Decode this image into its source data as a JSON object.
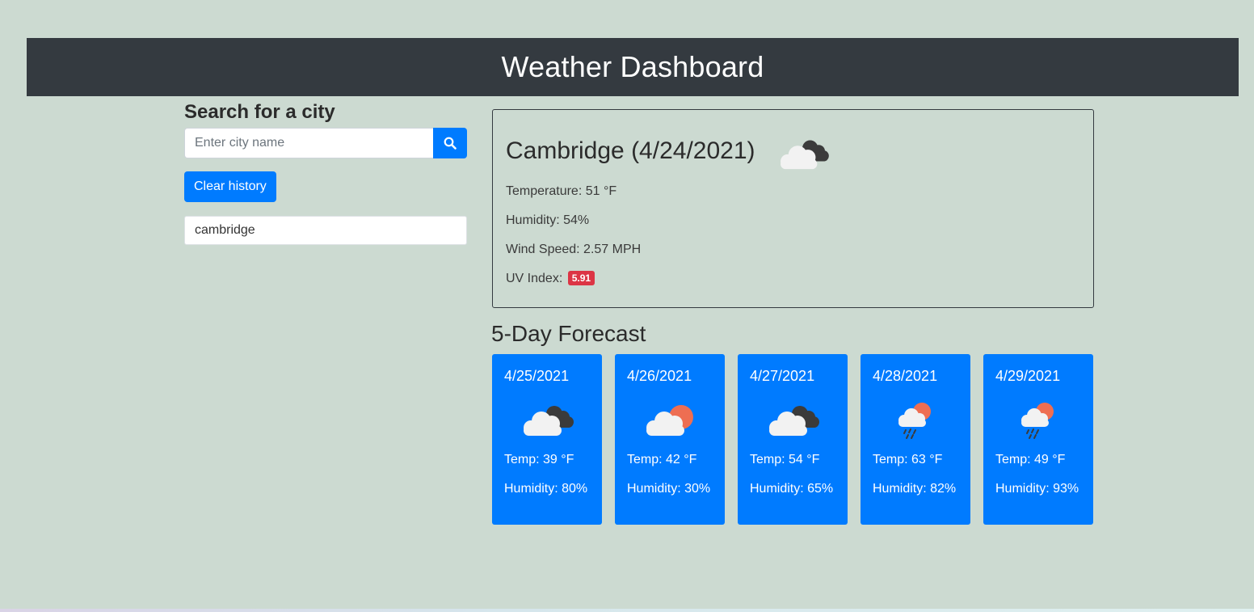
{
  "header": {
    "title": "Weather Dashboard"
  },
  "sidebar": {
    "heading": "Search for a city",
    "search_placeholder": "Enter city name",
    "search_value": "",
    "search_button_icon": "search-icon",
    "clear_history_label": "Clear history",
    "history": [
      {
        "label": "cambridge"
      }
    ]
  },
  "current": {
    "title": "Cambridge (4/24/2021)",
    "icon": "broken-clouds-icon",
    "temperature_label": "Temperature: 51 °F",
    "humidity_label": "Humidity: 54%",
    "wind_label": "Wind Speed: 2.57 MPH",
    "uv_label": "UV Index:",
    "uv_value": "5.91",
    "uv_color": "#dc3545"
  },
  "forecast": {
    "heading": "5-Day Forecast",
    "days": [
      {
        "date": "4/25/2021",
        "icon": "broken-clouds-icon",
        "temp": "Temp: 39 °F",
        "humidity": "Humidity: 80%"
      },
      {
        "date": "4/26/2021",
        "icon": "partly-cloudy-icon",
        "temp": "Temp: 42 °F",
        "humidity": "Humidity: 30%"
      },
      {
        "date": "4/27/2021",
        "icon": "broken-clouds-icon",
        "temp": "Temp: 54 °F",
        "humidity": "Humidity: 65%"
      },
      {
        "date": "4/28/2021",
        "icon": "rain-sun-icon",
        "temp": "Temp: 63 °F",
        "humidity": "Humidity: 82%"
      },
      {
        "date": "4/29/2021",
        "icon": "rain-sun-icon",
        "temp": "Temp: 49 °F",
        "humidity": "Humidity: 93%"
      }
    ]
  },
  "colors": {
    "page_background": "#ccdad1",
    "header_background": "#343a40",
    "accent": "#007bff",
    "uv_badge": "#dc3545"
  }
}
